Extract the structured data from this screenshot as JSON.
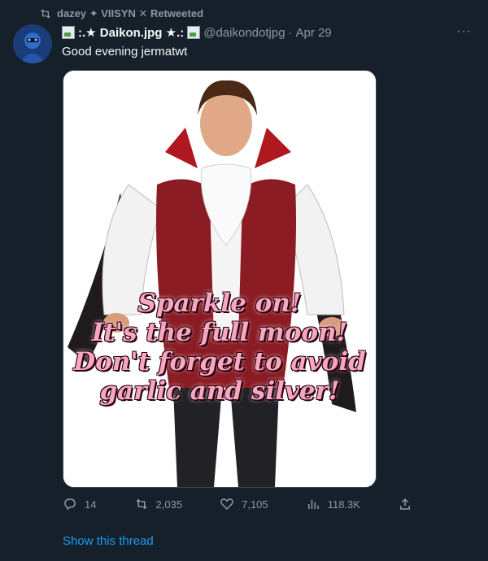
{
  "retweet": {
    "by": "dazey ✦ VIISYN ✕ Retweeted"
  },
  "tweet": {
    "display_name": ":.★ Daikon.jpg ★.:",
    "handle": "@daikondotjpg",
    "separator": "·",
    "date": "Apr 29",
    "text": "Good evening jermatwt",
    "more": "···"
  },
  "media": {
    "caption_lines": [
      "Sparkle on!",
      "It's the full moon!",
      "Don't forget to avoid",
      "garlic and silver!"
    ]
  },
  "actions": {
    "replies": "14",
    "retweets": "2,035",
    "likes": "7,105",
    "views": "118.3K"
  },
  "show_thread": "Show this thread",
  "colors": {
    "background": "#15202b",
    "muted": "#8b98a5",
    "link": "#1d9bf0",
    "text": "#f7f9f9"
  }
}
